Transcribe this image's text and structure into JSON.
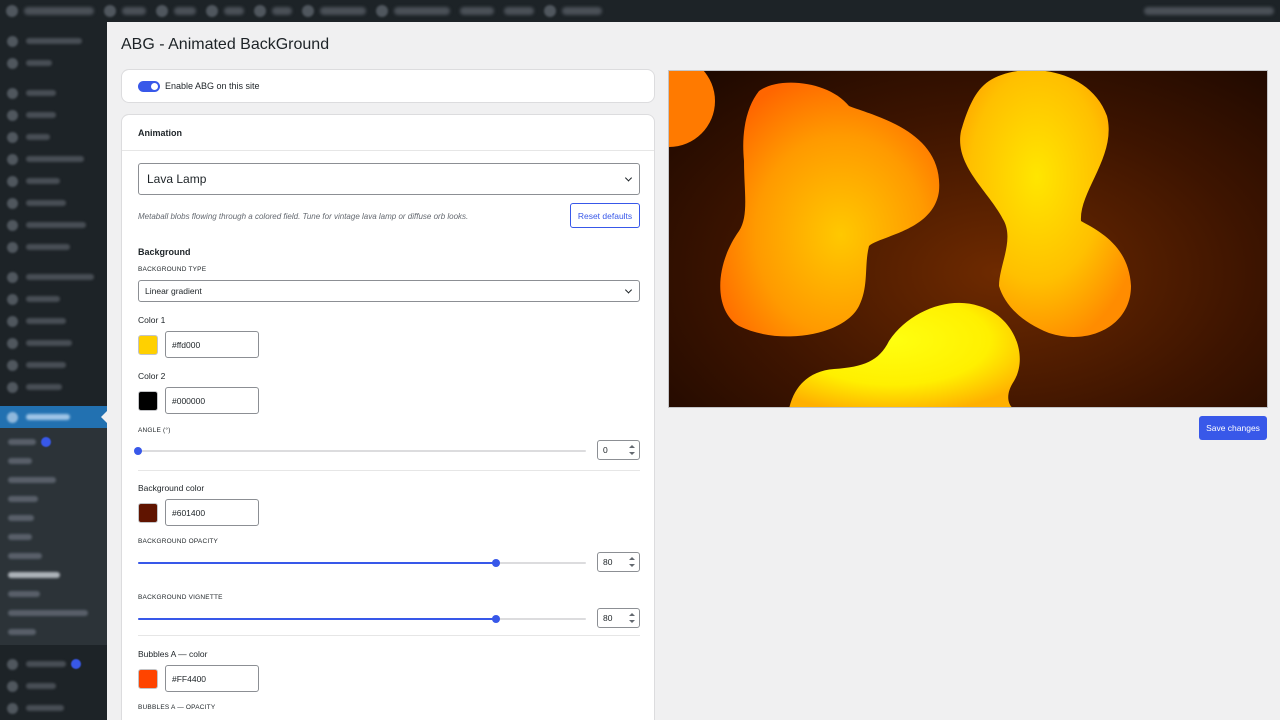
{
  "page": {
    "title": "ABG - Animated BackGround"
  },
  "enable": {
    "label": "Enable ABG on this site",
    "on": true
  },
  "animation": {
    "header": "Animation",
    "selected": "Lava Lamp",
    "description": "Metaball blobs flowing through a colored field. Tune for vintage lava lamp or diffuse orb looks.",
    "reset_label": "Reset defaults"
  },
  "background": {
    "section_title": "Background",
    "type_label": "BACKGROUND TYPE",
    "type_value": "Linear gradient",
    "color1_label": "Color 1",
    "color1_value": "#ffd000",
    "color2_label": "Color 2",
    "color2_value": "#000000",
    "angle_label": "ANGLE (°)",
    "angle_value": "0",
    "bg_color_label": "Background color",
    "bg_color_value": "#601400",
    "opacity_label": "BACKGROUND OPACITY",
    "opacity_value": "80",
    "vignette_label": "BACKGROUND VIGNETTE",
    "vignette_value": "80"
  },
  "bubbles_a": {
    "color_label": "Bubbles A — color",
    "color_value": "#FF4400",
    "opacity_label": "BUBBLES A — OPACITY"
  },
  "actions": {
    "save_label": "Save changes"
  },
  "colors": {
    "accent": "#3858e9",
    "sidebar_bg": "#1d2327",
    "swatch1": "#ffd000",
    "swatch2": "#000000",
    "swatch_bg": "#601400",
    "swatch_bubbles_a": "#FF4400"
  }
}
